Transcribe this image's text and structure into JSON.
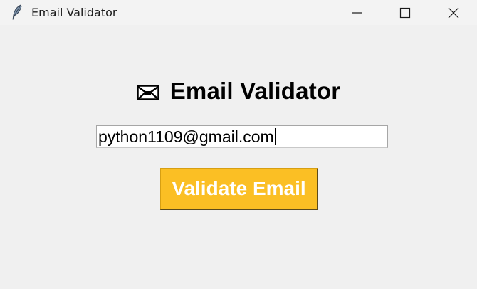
{
  "window": {
    "title": "Email Validator",
    "icon": "feather-icon",
    "controls": [
      "minimize-icon",
      "maximize-icon",
      "close-icon"
    ]
  },
  "main": {
    "heading_icon": "envelope-icon",
    "heading": "Email Validator",
    "email_value": "python1109@gmail.com",
    "validate_label": "Validate Email"
  },
  "colors": {
    "background": "#f0f0f0",
    "button_bg": "#fbbf24",
    "button_text": "#ffffff",
    "heading_text": "#000000"
  }
}
